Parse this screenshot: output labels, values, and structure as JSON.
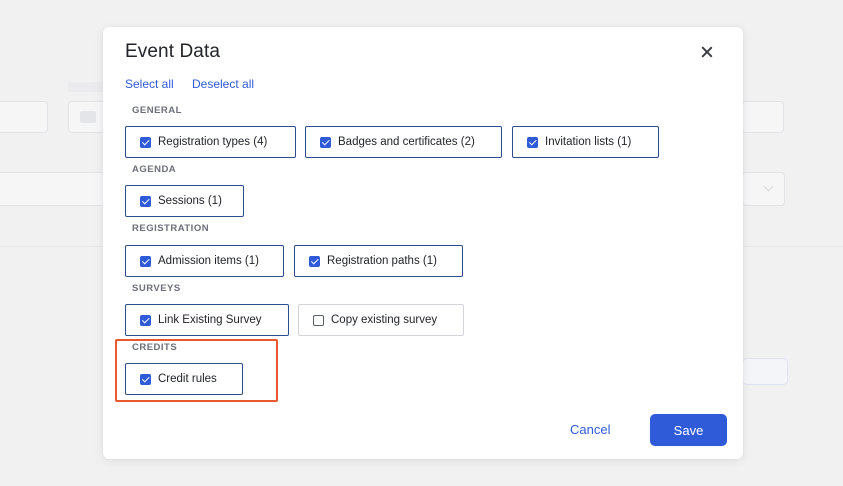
{
  "modal": {
    "title": "Event Data",
    "select_all": "Select all",
    "deselect_all": "Deselect all",
    "sections": {
      "general": {
        "label": "GENERAL",
        "items": [
          {
            "label": "Registration types (4)",
            "checked": true
          },
          {
            "label": "Badges and certificates (2)",
            "checked": true
          },
          {
            "label": "Invitation lists (1)",
            "checked": true
          }
        ]
      },
      "agenda": {
        "label": "AGENDA",
        "items": [
          {
            "label": "Sessions (1)",
            "checked": true
          }
        ]
      },
      "registration": {
        "label": "REGISTRATION",
        "items": [
          {
            "label": "Admission items (1)",
            "checked": true
          },
          {
            "label": "Registration paths (1)",
            "checked": true
          }
        ]
      },
      "surveys": {
        "label": "SURVEYS",
        "items": [
          {
            "label": "Link Existing Survey",
            "checked": true
          },
          {
            "label": "Copy existing survey",
            "checked": false
          }
        ]
      },
      "credits": {
        "label": "CREDITS",
        "items": [
          {
            "label": "Credit rules",
            "checked": true
          }
        ]
      }
    },
    "cancel_label": "Cancel",
    "save_label": "Save"
  },
  "colors": {
    "accent": "#2f5bd8",
    "item_border": "#2d4d8c",
    "highlight": "#e85a2e",
    "backdrop": "#f1f1f2"
  },
  "icons": {
    "close": "close-icon",
    "checkbox": "checkbox-icon"
  }
}
